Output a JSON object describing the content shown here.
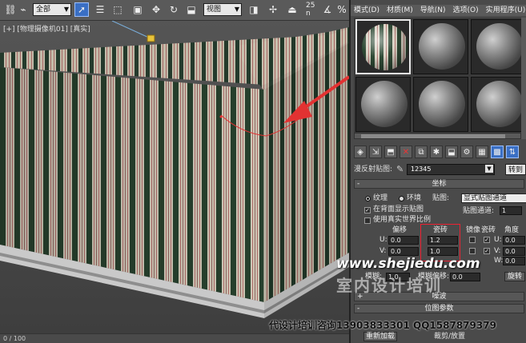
{
  "toolbar": {
    "filter_select": "全部",
    "view_select": "视图",
    "counter": "25",
    "counter_sub": "n"
  },
  "viewport": {
    "label": "[+] [物理摄像机01] [真实]",
    "status": "0 / 100"
  },
  "material_editor": {
    "menu": [
      "模式(D)",
      "材质(M)",
      "导航(N)",
      "选项(O)",
      "实用程序(U)"
    ],
    "map_label": "漫反射贴图:",
    "map_name": "12345",
    "goto_button": "转到",
    "coords_rollout": "坐标",
    "radio_texture": "纹理",
    "radio_env": "环境",
    "mapping_label": "贴图:",
    "mapping_value": "显式贴图通道",
    "show_back": "在背面显示贴图",
    "map_channel_label": "贴图通道:",
    "map_channel_value": "1",
    "real_world": "使用真实世界比例",
    "offset_label": "偏移",
    "tiling_label": "瓷砖",
    "mirror_label": "镜像",
    "tile_label": "瓷砖",
    "angle_label": "角度",
    "u_label": "U:",
    "v_label": "V:",
    "w_label": "W:",
    "u_offset": "0.0",
    "v_offset": "0.0",
    "u_tiling": "1.2",
    "v_tiling": "1.0",
    "u_angle": "0.0",
    "v_angle": "0.0",
    "w_angle": "0.0",
    "blur_label": "模糊:",
    "blur_value": "1.0",
    "blur_offset_label": "模糊偏移:",
    "blur_offset_value": "0.0",
    "rotate_button": "旋转",
    "noise_rollout": "噪波",
    "bitmap_rollout": "位图参数",
    "bitmap_label": "位图:",
    "bitmap_path": "C:\\Users\\Administrator\\Desktop\\...",
    "reload_button": "重新加载",
    "crop_label": "裁剪/放置"
  },
  "watermark": {
    "site": "www.shejiedu.com",
    "school": "室内设计培训",
    "contact": "代设计培训咨询13903833301 QQ1587879379"
  },
  "accent": {
    "selection_blue": "#3a6fc4",
    "annotation_red": "#e23232"
  }
}
